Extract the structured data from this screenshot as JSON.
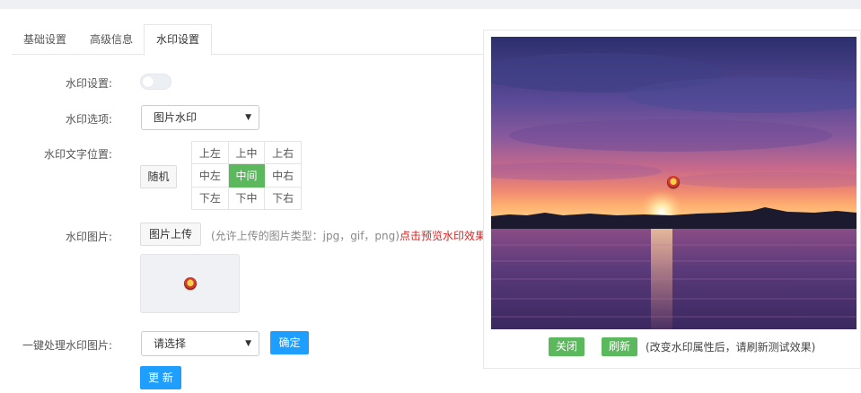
{
  "tabs": [
    {
      "label": "基础设置"
    },
    {
      "label": "高级信息"
    },
    {
      "label": "水印设置",
      "active": true
    }
  ],
  "form": {
    "watermark_toggle": {
      "label": "水印设置:",
      "enabled": false
    },
    "watermark_option": {
      "label": "水印选项:",
      "selected": "图片水印"
    },
    "text_position": {
      "label": "水印文字位置:",
      "random_button": "随机",
      "grid": [
        [
          "上左",
          "上中",
          "上右"
        ],
        [
          "中左",
          "中间",
          "中右"
        ],
        [
          "下左",
          "下中",
          "下右"
        ]
      ],
      "selected": "中间"
    },
    "watermark_image": {
      "label": "水印图片:",
      "upload_button": "图片上传",
      "hint": "(允许上传的图片类型：jpg，gif，png)",
      "preview_link": "点击预览水印效果"
    },
    "batch_process": {
      "label": "一键处理水印图片:",
      "select_value": "请选择",
      "confirm_button": "确定"
    },
    "update_button": "更 新"
  },
  "preview_panel": {
    "close_button": "关闭",
    "refresh_button": "刷新",
    "note": "(改变水印属性后，请刷新测试效果)"
  },
  "colors": {
    "primary_blue": "#1e9fff",
    "green": "#5cb85c",
    "link_red": "#e02020"
  },
  "icons": [
    "chevron-down-icon",
    "watermark-badge-icon"
  ]
}
